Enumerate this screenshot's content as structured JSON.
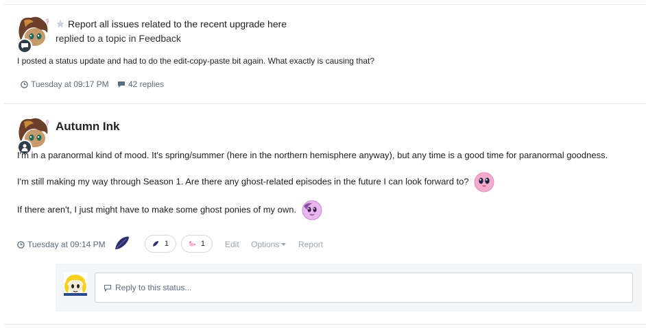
{
  "feed_item": {
    "topic_title": "Report all issues related to the recent upgrade here",
    "action_text": "replied to a topic in Feedback",
    "excerpt": "I posted a status update and had to do the edit-copy-paste bit again. What exactly is causing that?",
    "time": "Tuesday at 09:17 PM",
    "replies": "42 replies"
  },
  "status": {
    "author": "Autumn Ink",
    "line1": "I'm in a paranormal kind of mood. It's spring/summer (here in the northern hemisphere anyway), but any time is a good time for paranormal goodness.",
    "line2": "I'm still making my way through Season 1. Are there any ghost-related episodes in the future I can look forward to?",
    "line3": "If there aren't, I just might have to make some ghost ponies of my own.",
    "time": "Tuesday at 09:14 PM",
    "reactions": [
      {
        "icon": "feather-icon",
        "count": "1"
      },
      {
        "icon": "pony-icon",
        "count": "1"
      }
    ],
    "edit_label": "Edit",
    "options_label": "Options",
    "report_label": "Report"
  },
  "reply": {
    "placeholder": "Reply to this status..."
  },
  "colors": {
    "meta": "#5a6b80",
    "badge": "#2f3b4a",
    "reply_bg": "#f3f6f9"
  }
}
